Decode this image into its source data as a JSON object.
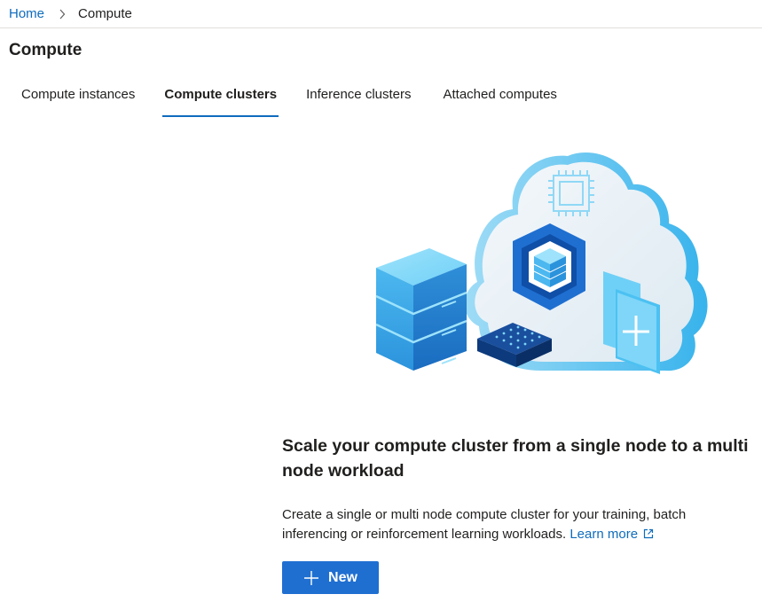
{
  "breadcrumb": {
    "home": "Home",
    "separator_icon": "chevron-right-icon",
    "current": "Compute"
  },
  "page": {
    "title": "Compute"
  },
  "tabs": [
    {
      "label": "Compute instances",
      "active": false
    },
    {
      "label": "Compute clusters",
      "active": true
    },
    {
      "label": "Inference clusters",
      "active": false
    },
    {
      "label": "Attached computes",
      "active": false
    }
  ],
  "empty_state": {
    "illustration_icon": "cloud-compute-illustration",
    "heading": "Scale your compute cluster from a single node to a multi node workload",
    "description": "Create a single or multi node compute cluster for your training, batch inferencing or reinforcement learning workloads.",
    "learn_more": "Learn more",
    "learn_more_icon": "external-link-icon",
    "new_button": "New",
    "new_button_icon": "plus-icon"
  },
  "colors": {
    "accent": "#0f6cbd",
    "button": "#1f6fd1",
    "divider": "#e1dfdd"
  }
}
